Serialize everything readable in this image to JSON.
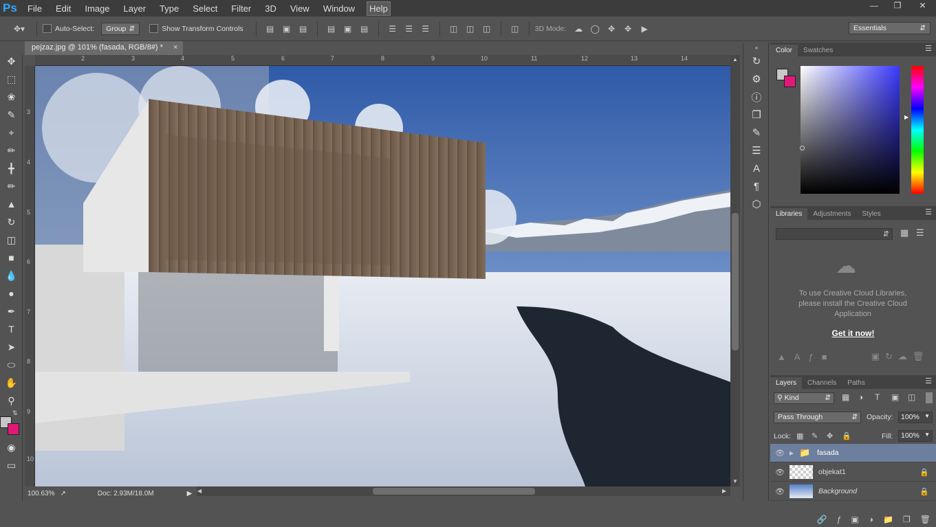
{
  "app": {
    "logo": "Ps"
  },
  "menu": [
    "File",
    "Edit",
    "Image",
    "Layer",
    "Type",
    "Select",
    "Filter",
    "3D",
    "View",
    "Window",
    "Help"
  ],
  "options": {
    "auto_select": "Auto-Select:",
    "group_value": "Group",
    "show_transform": "Show Transform Controls",
    "mode_3d": "3D Mode:",
    "workspace": "Essentials"
  },
  "document": {
    "tab_title": "pejzaz.jpg @ 101% (fasada, RGB/8#) *",
    "zoom": "100.63%",
    "doc_info": "Doc: 2.93M/18.0M"
  },
  "rulers": {
    "h": [
      "2",
      "3",
      "4",
      "5",
      "6",
      "7",
      "8",
      "9",
      "10",
      "11",
      "12",
      "13",
      "14"
    ],
    "v": [
      "3",
      "4",
      "5",
      "6",
      "7",
      "8",
      "9",
      "10"
    ]
  },
  "panels": {
    "color_tabs": [
      "Color",
      "Swatches"
    ],
    "lib_tabs": [
      "Libraries",
      "Adjustments",
      "Styles"
    ],
    "lib_message": "To use Creative Cloud Libraries, please install the Creative Cloud Application",
    "lib_link": "Get it now!",
    "layer_tabs": [
      "Layers",
      "Channels",
      "Paths"
    ],
    "kind": "Kind",
    "blend_mode": "Pass Through",
    "opacity_label": "Opacity:",
    "opacity": "100%",
    "lock_label": "Lock:",
    "fill_label": "Fill:",
    "fill": "100%"
  },
  "layers": [
    {
      "name": "fasada",
      "type": "group",
      "selected": true
    },
    {
      "name": "objekat1",
      "type": "layer",
      "locked": true
    },
    {
      "name": "Background",
      "type": "background",
      "locked": true
    }
  ],
  "colors": {
    "foreground": "#c8c8c8",
    "background": "#e0187a",
    "accent": "#31a8ff",
    "selected_layer": "#6d7f9e"
  }
}
